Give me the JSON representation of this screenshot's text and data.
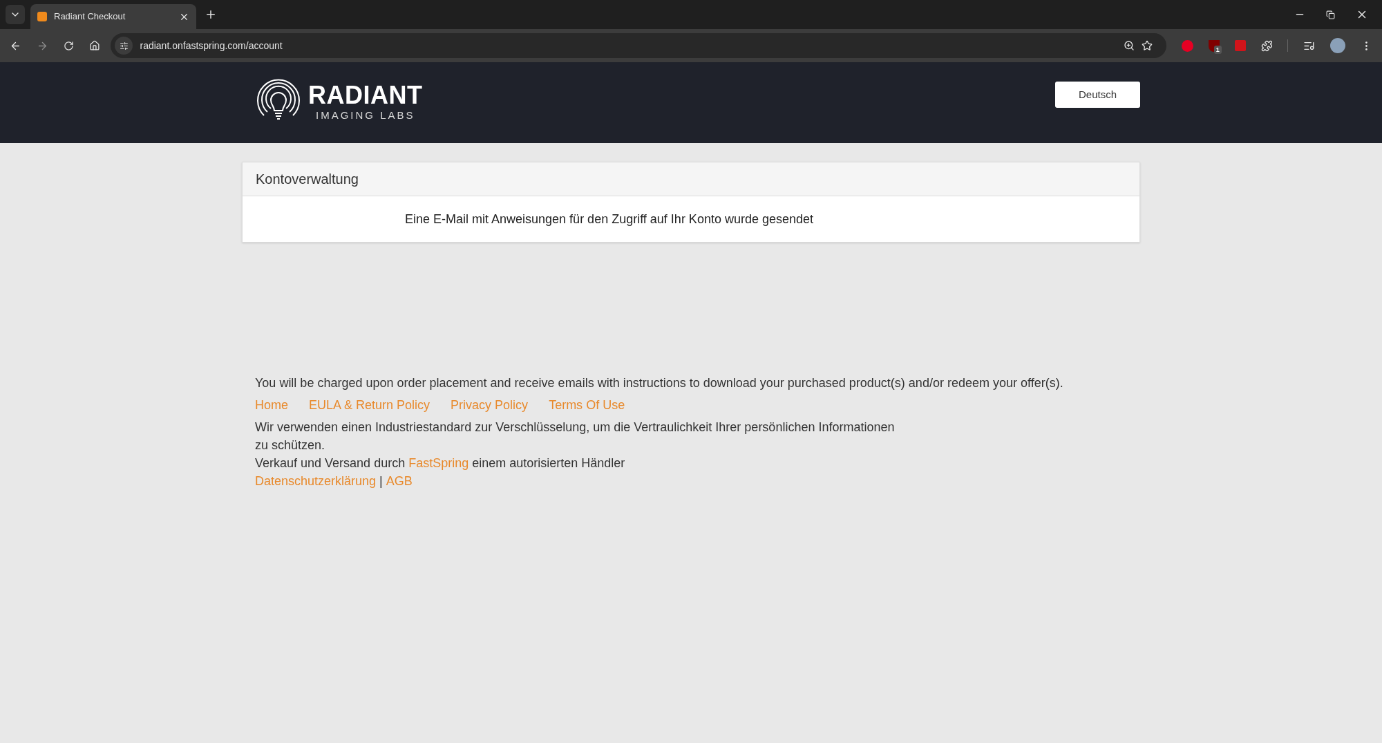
{
  "browser": {
    "tab_title": "Radiant Checkout",
    "address": "radiant.onfastspring.com/account",
    "extension_badge": "1"
  },
  "header": {
    "logo_title": "RADIANT",
    "logo_subtitle": "IMAGING LABS",
    "language_button": "Deutsch"
  },
  "card": {
    "title": "Kontoverwaltung",
    "message": "Eine E-Mail mit Anweisungen für den Zugriff auf Ihr Konto wurde gesendet"
  },
  "footer": {
    "notice": "You will be charged upon order placement and receive emails with instructions to download your purchased product(s) and/or redeem your offer(s).",
    "links": [
      "Home",
      "EULA & Return Policy",
      "Privacy Policy",
      "Terms Of Use"
    ],
    "encryption": "Wir verwenden einen Industriestandard zur Verschlüsselung, um die Vertraulichkeit Ihrer persönlichen Informationen zu schützen.",
    "seller": {
      "before": "Verkauf und Versand durch",
      "link": "FastSpring",
      "after": "einem autorisierten Händler"
    },
    "legal_links": [
      "Datenschutzerklärung",
      "AGB"
    ],
    "legal_separator": "|"
  }
}
